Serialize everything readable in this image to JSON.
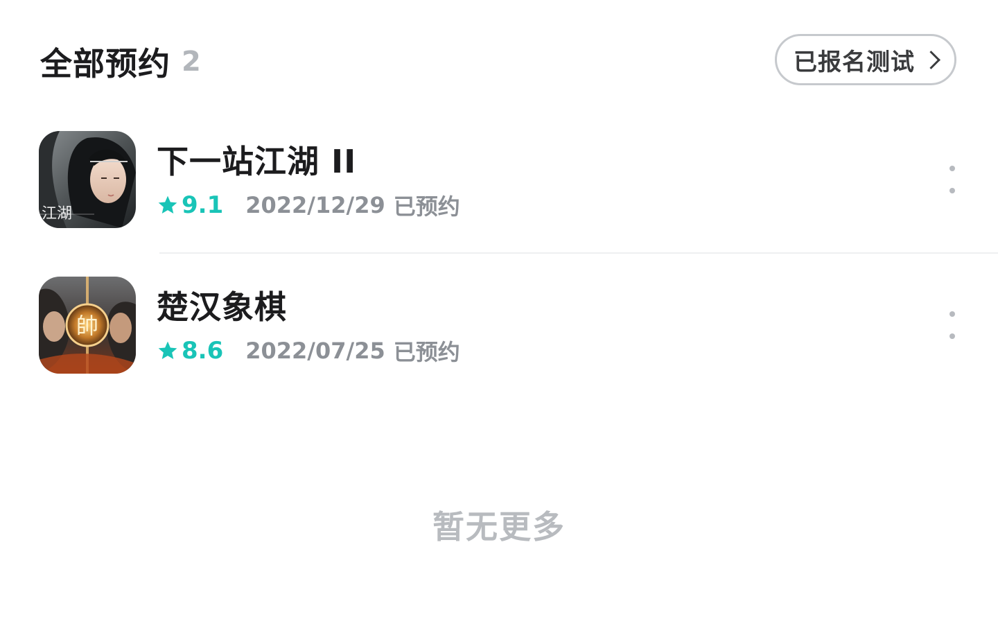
{
  "header": {
    "title": "全部预约",
    "count": "2",
    "test_button_label": "已报名测试"
  },
  "items": [
    {
      "name": "下一站江湖 II",
      "score": "9.1",
      "date": "2022/12/29",
      "status": "已预约",
      "icon": "jianghu-game-icon"
    },
    {
      "name": "楚汉象棋",
      "score": "8.6",
      "date": "2022/07/25",
      "status": "已预约",
      "icon": "chuhan-chess-game-icon"
    }
  ],
  "footer": {
    "end_text": "暂无更多"
  },
  "colors": {
    "accent": "#19c4b7",
    "title": "#1c1c1e",
    "muted": "#8c9096",
    "divider": "#eeeff1"
  }
}
